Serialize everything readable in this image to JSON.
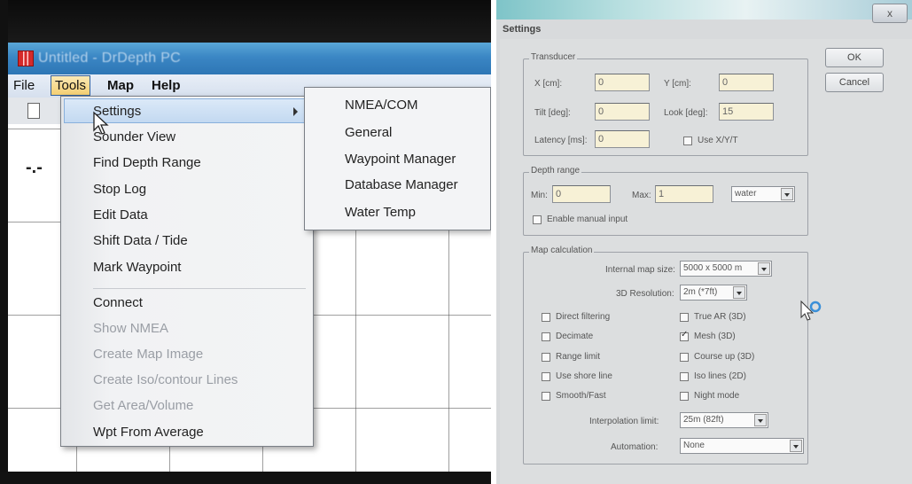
{
  "app": {
    "title": "Untitled - DrDepth PC"
  },
  "menubar": {
    "items": [
      "File",
      "Tools",
      "Map",
      "Help"
    ]
  },
  "tools_menu": {
    "items": [
      {
        "label": "Settings",
        "enabled": true,
        "submenu": true,
        "highlighted": true
      },
      {
        "label": "Sounder View",
        "enabled": true
      },
      {
        "label": "Find Depth Range",
        "enabled": true
      },
      {
        "label": "Stop Log",
        "enabled": true
      },
      {
        "label": "Edit Data",
        "enabled": true
      },
      {
        "label": "Shift Data / Tide",
        "enabled": true
      },
      {
        "label": "Mark Waypoint",
        "enabled": true
      },
      {
        "label": "Connect",
        "enabled": true
      },
      {
        "label": "Show NMEA",
        "enabled": false
      },
      {
        "label": "Create Map Image",
        "enabled": false
      },
      {
        "label": "Create Iso/contour Lines",
        "enabled": false
      },
      {
        "label": "Get Area/Volume",
        "enabled": false
      },
      {
        "label": "Wpt From Average",
        "enabled": true
      }
    ]
  },
  "settings_submenu": {
    "items": [
      "NMEA/COM",
      "General",
      "Waypoint Manager",
      "Database Manager",
      "Water Temp"
    ]
  },
  "canvas": {
    "marker_text": "-.-"
  },
  "dialog": {
    "title": "Settings",
    "close_glyph": "x",
    "ok_label": "OK",
    "cancel_label": "Cancel",
    "transducer": {
      "legend": "Transducer",
      "x_label": "X [cm]:",
      "x_value": "0",
      "y_label": "Y [cm]:",
      "y_value": "0",
      "tilt_label": "Tilt [deg]:",
      "tilt_value": "0",
      "look_label": "Look [deg]:",
      "look_value": "15",
      "latency_label": "Latency [ms]:",
      "latency_value": "0",
      "use_xyz_label": "Use X/Y/T",
      "use_xyz_checked": false
    },
    "depth_range": {
      "legend": "Depth range",
      "min_label": "Min:",
      "min_value": "0",
      "max_label": "Max:",
      "max_value": "1",
      "unit_value": "water",
      "manual_label": "Enable manual input",
      "manual_checked": false
    },
    "map_calc": {
      "legend": "Map calculation",
      "map_size_label": "Internal map size:",
      "map_size_value": "5000 x 5000 m",
      "res_label": "3D Resolution:",
      "res_value": "2m (*7ft)",
      "checkboxes_left": [
        {
          "label": "Direct filtering",
          "checked": false
        },
        {
          "label": "Decimate",
          "checked": false
        },
        {
          "label": "Range limit",
          "checked": false
        },
        {
          "label": "Use shore line",
          "checked": false
        },
        {
          "label": "Smooth/Fast",
          "checked": false
        }
      ],
      "checkboxes_right": [
        {
          "label": "True AR (3D)",
          "checked": false
        },
        {
          "label": "Mesh (3D)",
          "checked": true
        },
        {
          "label": "Course up (3D)",
          "checked": false
        },
        {
          "label": "Iso lines (2D)",
          "checked": false
        },
        {
          "label": "Night mode",
          "checked": false
        }
      ],
      "interp_label": "Interpolation limit:",
      "interp_value": "25m (82ft)",
      "auto_label": "Automation:",
      "auto_value": "None"
    }
  }
}
